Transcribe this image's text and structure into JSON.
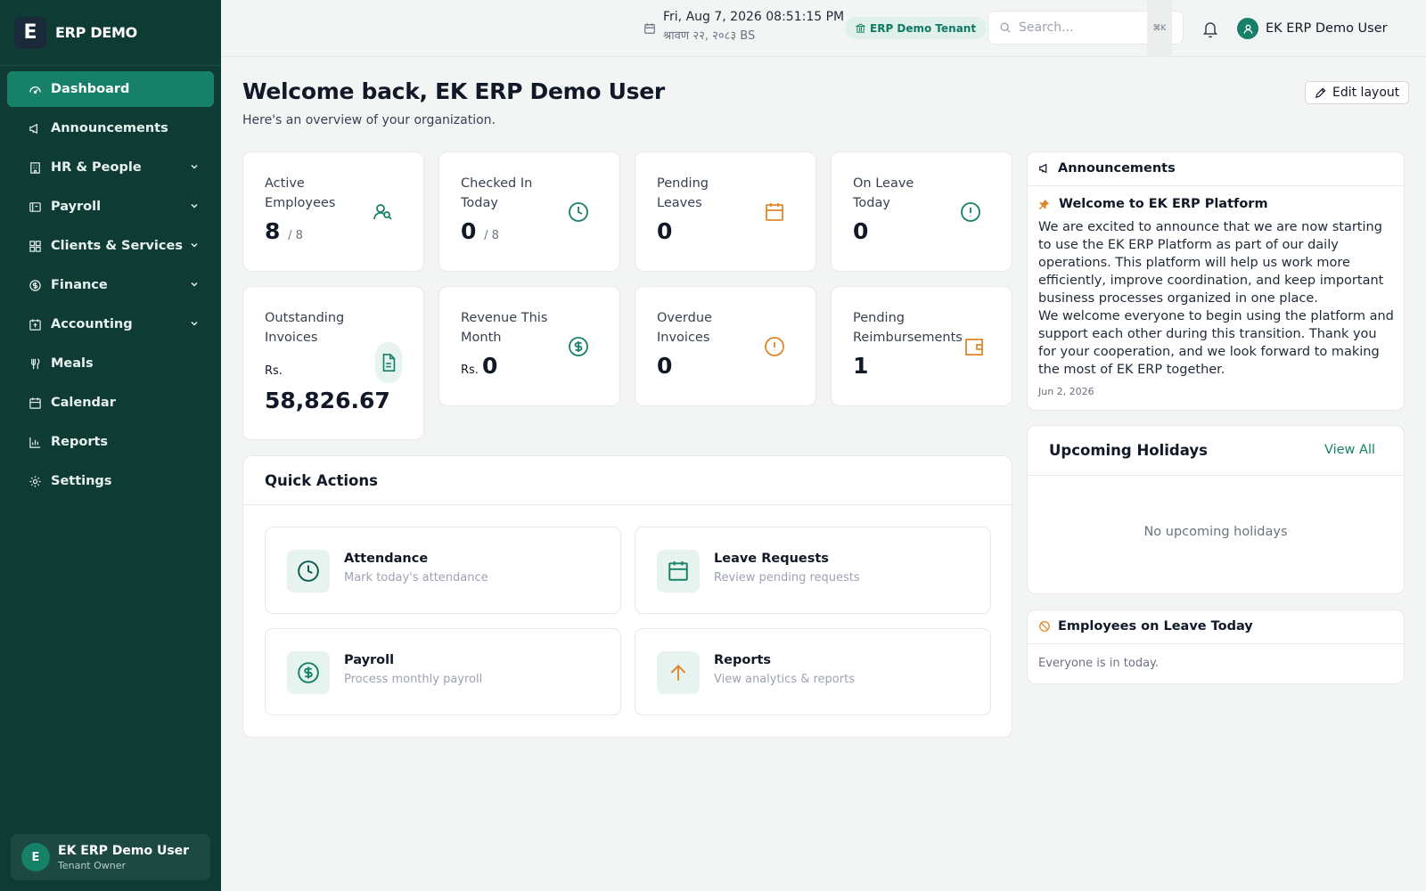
{
  "brand": {
    "name": "ERP DEMO",
    "logo_letter": "E"
  },
  "sidebar": {
    "items": [
      {
        "label": "Dashboard",
        "icon": "dashboard-icon",
        "active": true,
        "expandable": false
      },
      {
        "label": "Announcements",
        "icon": "megaphone-icon",
        "active": false,
        "expandable": false
      },
      {
        "label": "HR & People",
        "icon": "building-icon",
        "active": false,
        "expandable": true
      },
      {
        "label": "Payroll",
        "icon": "wallet-icon",
        "active": false,
        "expandable": true
      },
      {
        "label": "Clients & Services",
        "icon": "grid-icon",
        "active": false,
        "expandable": true
      },
      {
        "label": "Finance",
        "icon": "dollar-circle-icon",
        "active": false,
        "expandable": true
      },
      {
        "label": "Accounting",
        "icon": "ledger-icon",
        "active": false,
        "expandable": true
      },
      {
        "label": "Meals",
        "icon": "food-icon",
        "active": false,
        "expandable": false
      },
      {
        "label": "Calendar",
        "icon": "calendar-icon",
        "active": false,
        "expandable": false
      },
      {
        "label": "Reports",
        "icon": "bar-chart-icon",
        "active": false,
        "expandable": false
      },
      {
        "label": "Settings",
        "icon": "gear-icon",
        "active": false,
        "expandable": false
      }
    ],
    "user": {
      "initial": "E",
      "name": "EK ERP Demo User",
      "role": "Tenant Owner"
    }
  },
  "header": {
    "datetime": "Fri, Aug 7, 2026 08:51:15 PM",
    "date_bs": "श्रावण २२, २०८३ BS",
    "tenant": "ERP Demo Tenant",
    "search_placeholder": "Search...",
    "search_shortcut": "⌘K",
    "username": "EK ERP Demo User"
  },
  "main": {
    "title": "Welcome back, EK ERP Demo User",
    "subtitle": "Here's an overview of your organization.",
    "edit_layout_label": "Edit layout",
    "stats": [
      {
        "label_line1": "Active",
        "label_line2": "Employees",
        "value": "8",
        "suffix": "/ 8",
        "icon": "users-icon"
      },
      {
        "label_line1": "Checked In",
        "label_line2": "Today",
        "value": "0",
        "suffix": "/ 8",
        "icon": "clock-icon"
      },
      {
        "label_line1": "Pending",
        "label_line2": "Leaves",
        "value": "0",
        "icon": "calendar-icon"
      },
      {
        "label_line1": "On Leave",
        "label_line2": "Today",
        "value": "0",
        "icon": "alert-circle-icon"
      },
      {
        "label_line1": "Outstanding",
        "label_line2": "Invoices",
        "prefix": "Rs.",
        "value": "58,826.67",
        "icon": "document-icon"
      },
      {
        "label_line1": "Revenue This",
        "label_line2": "Month",
        "prefix": "Rs.",
        "value": "0",
        "icon": "dollar-circle-icon"
      },
      {
        "label_line1": "Overdue",
        "label_line2": "Invoices",
        "value": "0",
        "icon": "alert-circle-icon"
      },
      {
        "label_line1": "Pending",
        "label_line2": "Reimbursements",
        "value": "1",
        "icon": "wallet-icon"
      }
    ],
    "quick_actions": {
      "title": "Quick Actions",
      "items": [
        {
          "name": "Attendance",
          "description": "Mark today's attendance",
          "icon": "clock-icon"
        },
        {
          "name": "Leave Requests",
          "description": "Review pending requests",
          "icon": "calendar-icon"
        },
        {
          "name": "Payroll",
          "description": "Process monthly payroll",
          "icon": "dollar-circle-icon"
        },
        {
          "name": "Reports",
          "description": "View analytics & reports",
          "icon": "arrow-up-icon"
        }
      ]
    }
  },
  "announcements_panel": {
    "title": "Announcements",
    "item_title": "Welcome to EK ERP Platform",
    "body_p1": "We are excited to announce that we are now starting to use the EK ERP Platform as part of our daily operations. This platform will help us work more efficiently, improve coordination, and keep important business processes organized in one place.",
    "body_p2": "We welcome everyone to begin using the platform and support each other during this transition. Thank you for your cooperation, and we look forward to making the most of EK ERP together.",
    "date": "Jun 2, 2026"
  },
  "holidays_panel": {
    "title": "Upcoming Holidays",
    "view_all": "View All",
    "empty": "No upcoming holidays"
  },
  "leave_panel": {
    "title": "Employees on Leave Today",
    "empty": "Everyone is in today."
  },
  "colors": {
    "sidebar_bg": "#0f3b35",
    "accent": "#168168",
    "orange": "#e0862b",
    "page_bg": "#f3f5f4"
  }
}
